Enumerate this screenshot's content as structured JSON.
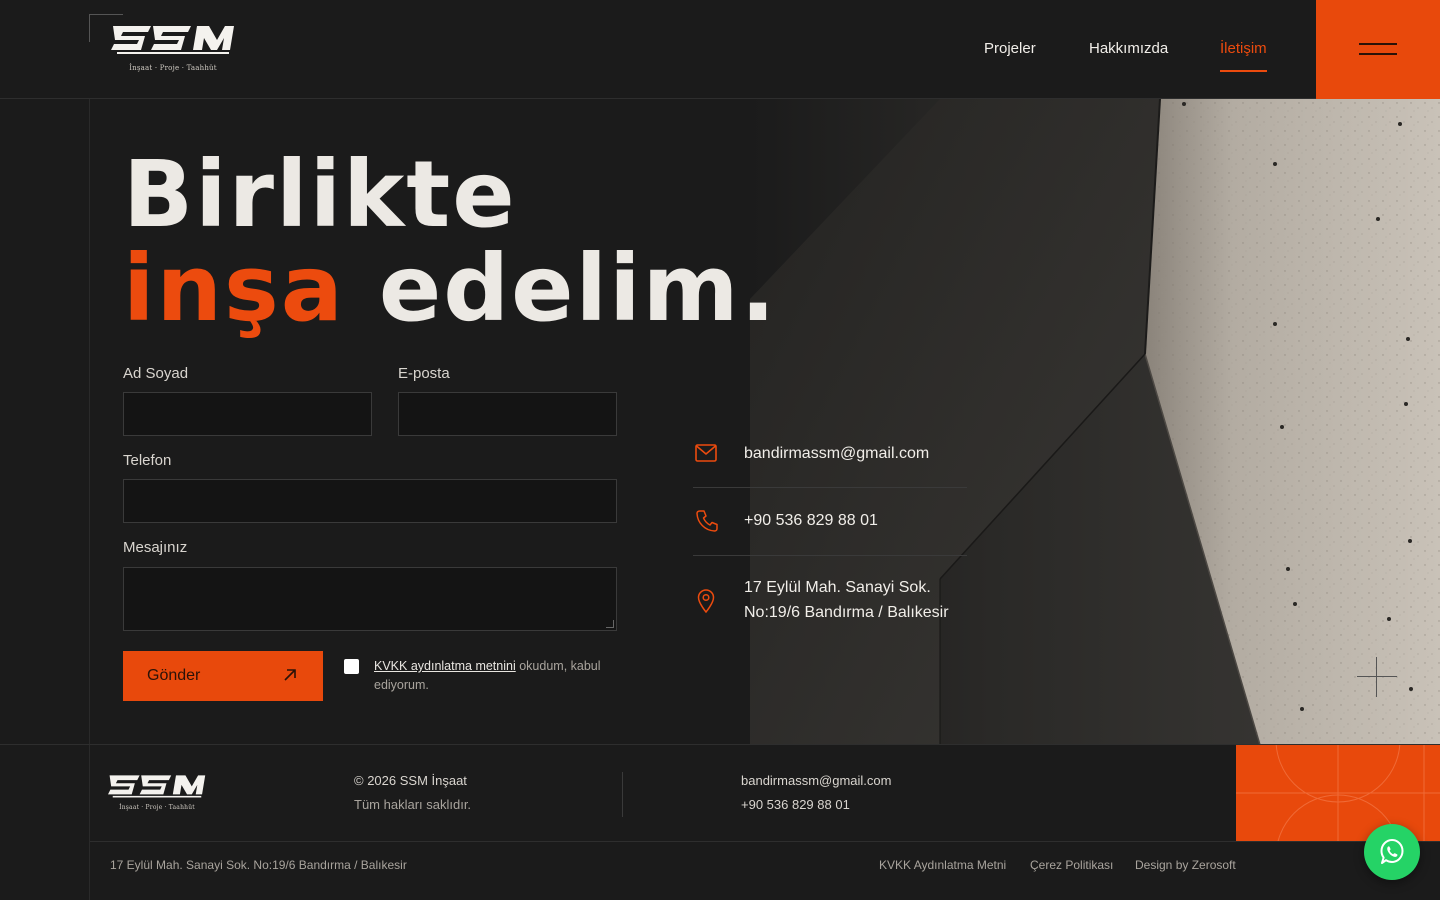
{
  "brand": {
    "logo_text": "SSM",
    "tagline": "İnşaat · Proje · Taahhüt"
  },
  "nav": {
    "items": [
      {
        "label": "Projeler"
      },
      {
        "label": "Hakkımızda"
      },
      {
        "label": "İletişim",
        "active": true
      }
    ],
    "menu_icon": "hamburger-icon"
  },
  "hero": {
    "line1": "Birlikte",
    "accent": "inşa",
    "rest": " edelim."
  },
  "form": {
    "name_label": "Ad Soyad",
    "name_value": "",
    "email_label": "E-posta",
    "email_value": "",
    "phone_label": "Telefon",
    "phone_value": "",
    "message_label": "Mesajınız",
    "message_value": "",
    "submit_label": "Gönder",
    "submit_icon": "arrow-up-right-icon",
    "consent_link": "KVKK aydınlatma metnini",
    "consent_rest": " okudum, kabul ediyorum.",
    "consent_checked": false
  },
  "contact": {
    "email": "bandirmassm@gmail.com",
    "phone": "+90 536 829 88 01",
    "address_line1": "17 Eylül Mah. Sanayi Sok.",
    "address_line2": "No:19/6 Bandırma / Balıkesir",
    "icons": [
      "mail-icon",
      "phone-icon",
      "location-pin-icon"
    ]
  },
  "footer": {
    "copyright": "© 2026 SSM İnşaat",
    "rights": "Tüm hakları saklıdır.",
    "email": "bandirmassm@gmail.com",
    "phone": "+90 536 829 88 01",
    "address": "17 Eylül Mah. Sanayi Sok. No:19/6 Bandırma / Balıkesir",
    "links": [
      "KVKK Aydınlatma Metni",
      "Çerez Politikası",
      "Design by Zerosoft"
    ]
  },
  "colors": {
    "accent": "#e8490c",
    "background": "#1b1b1b",
    "whatsapp": "#25d366"
  }
}
